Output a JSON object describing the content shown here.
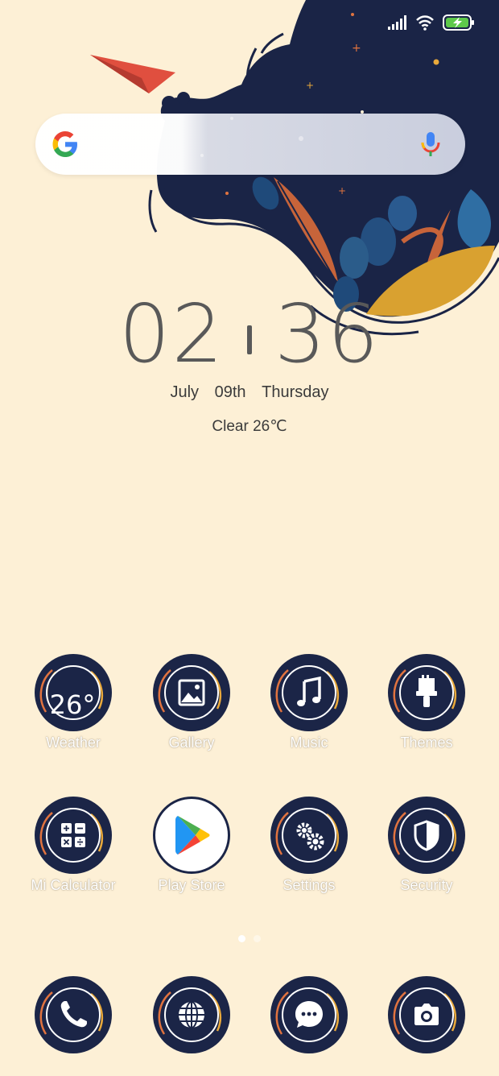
{
  "search": {
    "placeholder": ""
  },
  "clock": {
    "hours": "02",
    "minutes": "36"
  },
  "date": {
    "month": "July",
    "day": "09th",
    "weekday": "Thursday"
  },
  "weather": {
    "text": "Clear 26℃"
  },
  "apps_row1": [
    {
      "label": "Weather",
      "icon": "weather-icon",
      "badge": "26°"
    },
    {
      "label": "Gallery",
      "icon": "gallery-icon"
    },
    {
      "label": "Music",
      "icon": "music-icon"
    },
    {
      "label": "Themes",
      "icon": "themes-icon"
    }
  ],
  "apps_row2": [
    {
      "label": "Mi Calculator",
      "icon": "calculator-icon"
    },
    {
      "label": "Play Store",
      "icon": "play-store-icon"
    },
    {
      "label": "Settings",
      "icon": "settings-icon"
    },
    {
      "label": "Security",
      "icon": "security-icon"
    }
  ],
  "dock": [
    {
      "icon": "phone-icon"
    },
    {
      "icon": "browser-icon"
    },
    {
      "icon": "messages-icon"
    },
    {
      "icon": "camera-icon"
    }
  ],
  "pages": {
    "count": 2,
    "active": 1
  },
  "colors": {
    "background": "#fdf0d6",
    "icon_bg": "#1b2547",
    "accent_orange": "#e0733f",
    "accent_yellow": "#e9a93b",
    "battery": "#5ec94a"
  }
}
